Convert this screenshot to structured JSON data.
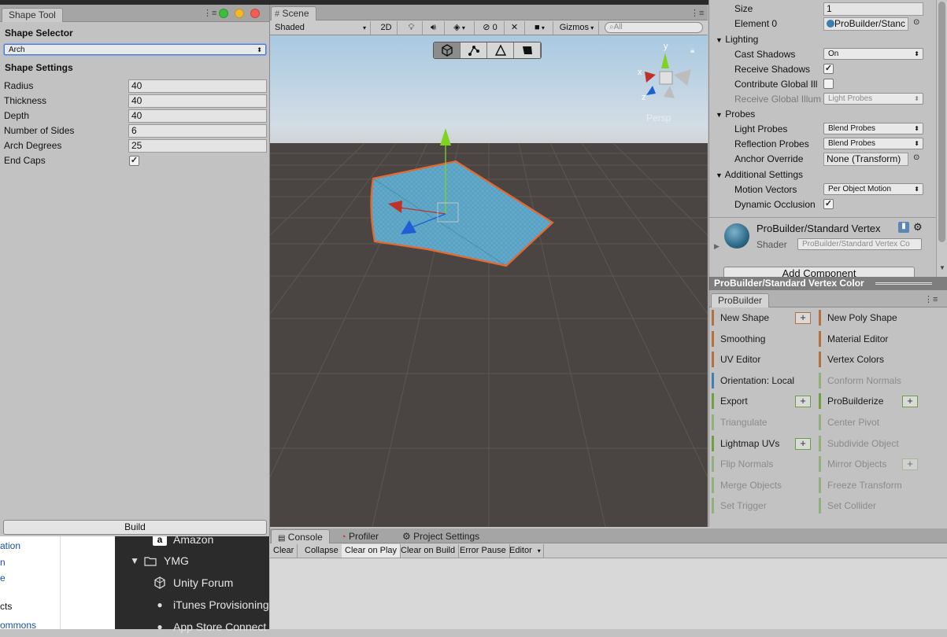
{
  "shape_tool": {
    "tab_title": "Shape Tool",
    "shape_selector_heading": "Shape Selector",
    "shape_selected": "Arch",
    "shape_settings_heading": "Shape Settings",
    "fields": [
      {
        "label": "Radius",
        "value": "40"
      },
      {
        "label": "Thickness",
        "value": "40"
      },
      {
        "label": "Depth",
        "value": "40"
      },
      {
        "label": "Number of Sides",
        "value": "6"
      },
      {
        "label": "Arch Degrees",
        "value": "25"
      }
    ],
    "end_caps_label": "End Caps",
    "end_caps_checked": true,
    "build_label": "Build"
  },
  "scene": {
    "tab_title": "Scene",
    "shading_mode": "Shaded",
    "toggle_2d": "2D",
    "hidden_count": "0",
    "gizmos_label": "Gizmos",
    "search_placeholder": "All",
    "projection": "Persp",
    "axis_labels": {
      "x": "x",
      "y": "y",
      "z": "z"
    }
  },
  "inspector": {
    "size_label": "Size",
    "size_value": "1",
    "element0_label": "Element 0",
    "element0_value": "ProBuilder/Stanc",
    "lighting_label": "Lighting",
    "cast_shadows_label": "Cast Shadows",
    "cast_shadows_value": "On",
    "receive_shadows_label": "Receive Shadows",
    "contribute_gi_label": "Contribute Global Ill",
    "receive_gi_label": "Receive Global Illum",
    "receive_gi_value": "Light Probes",
    "probes_label": "Probes",
    "light_probes_label": "Light Probes",
    "light_probes_value": "Blend Probes",
    "reflection_probes_label": "Reflection Probes",
    "reflection_probes_value": "Blend Probes",
    "anchor_override_label": "Anchor Override",
    "anchor_override_value": "None (Transform)",
    "additional_settings_label": "Additional Settings",
    "motion_vectors_label": "Motion Vectors",
    "motion_vectors_value": "Per Object Motion",
    "dynamic_occlusion_label": "Dynamic Occlusion",
    "material_name": "ProBuilder/Standard Vertex",
    "shader_label": "Shader",
    "shader_value": "ProBuilder/Standard Vertex Co",
    "add_component_label": "Add Component"
  },
  "material_strip_label": "ProBuilder/Standard Vertex Color",
  "probuilder": {
    "tab_title": "ProBuilder",
    "buttons": [
      {
        "label": "New Shape",
        "color": "#b5703f",
        "plus": true,
        "dim": false
      },
      {
        "label": "New Poly Shape",
        "color": "#b5703f",
        "plus": false,
        "dim": false
      },
      {
        "label": "Smoothing",
        "color": "#b5703f",
        "plus": false,
        "dim": false
      },
      {
        "label": "Material Editor",
        "color": "#b5703f",
        "plus": false,
        "dim": false
      },
      {
        "label": "UV Editor",
        "color": "#b5703f",
        "plus": false,
        "dim": false
      },
      {
        "label": "Vertex Colors",
        "color": "#b5703f",
        "plus": false,
        "dim": false
      },
      {
        "label": "Orientation: Local",
        "color": "#3f7fb5",
        "plus": false,
        "dim": false
      },
      {
        "label": "Conform Normals",
        "color": "#8fb27a",
        "plus": false,
        "dim": true
      },
      {
        "label": "Export",
        "color": "#6da041",
        "plus": true,
        "dim": false
      },
      {
        "label": "ProBuilderize",
        "color": "#6da041",
        "plus": true,
        "dim": false
      },
      {
        "label": "Triangulate",
        "color": "#8fb27a",
        "plus": false,
        "dim": true
      },
      {
        "label": "Center Pivot",
        "color": "#8fb27a",
        "plus": false,
        "dim": true
      },
      {
        "label": "Lightmap UVs",
        "color": "#6da041",
        "plus": true,
        "dim": false
      },
      {
        "label": "Subdivide Object",
        "color": "#8fb27a",
        "plus": false,
        "dim": true
      },
      {
        "label": "Flip Normals",
        "color": "#8fb27a",
        "plus": false,
        "dim": true
      },
      {
        "label": "Mirror Objects",
        "color": "#8fb27a",
        "plus": true,
        "dim": true
      },
      {
        "label": "Merge Objects",
        "color": "#8fb27a",
        "plus": false,
        "dim": true
      },
      {
        "label": "Freeze Transform",
        "color": "#8fb27a",
        "plus": false,
        "dim": true
      },
      {
        "label": "Set Trigger",
        "color": "#8fb27a",
        "plus": false,
        "dim": true
      },
      {
        "label": "Set Collider",
        "color": "#8fb27a",
        "plus": false,
        "dim": true
      }
    ]
  },
  "console": {
    "tabs": [
      "Console",
      "Profiler",
      "Project Settings"
    ],
    "buttons": [
      "Clear",
      "Collapse",
      "Clear on Play",
      "Clear on Build",
      "Error Pause",
      "Editor"
    ]
  },
  "background": {
    "left_links": [
      "ation",
      "n",
      "e",
      "cts",
      "ommons"
    ],
    "finder_items": [
      "Amazon",
      "YMG",
      "Unity Forum",
      "iTunes Provisioning",
      "App Store Connect"
    ]
  },
  "colors": {
    "scene_ground": "#4a4542",
    "mesh_fill": "#5aa2c4",
    "mesh_outline": "#e8672b",
    "handle_y": "#7ed321",
    "handle_x": "#c0312a",
    "handle_z": "#1f5fd6"
  }
}
